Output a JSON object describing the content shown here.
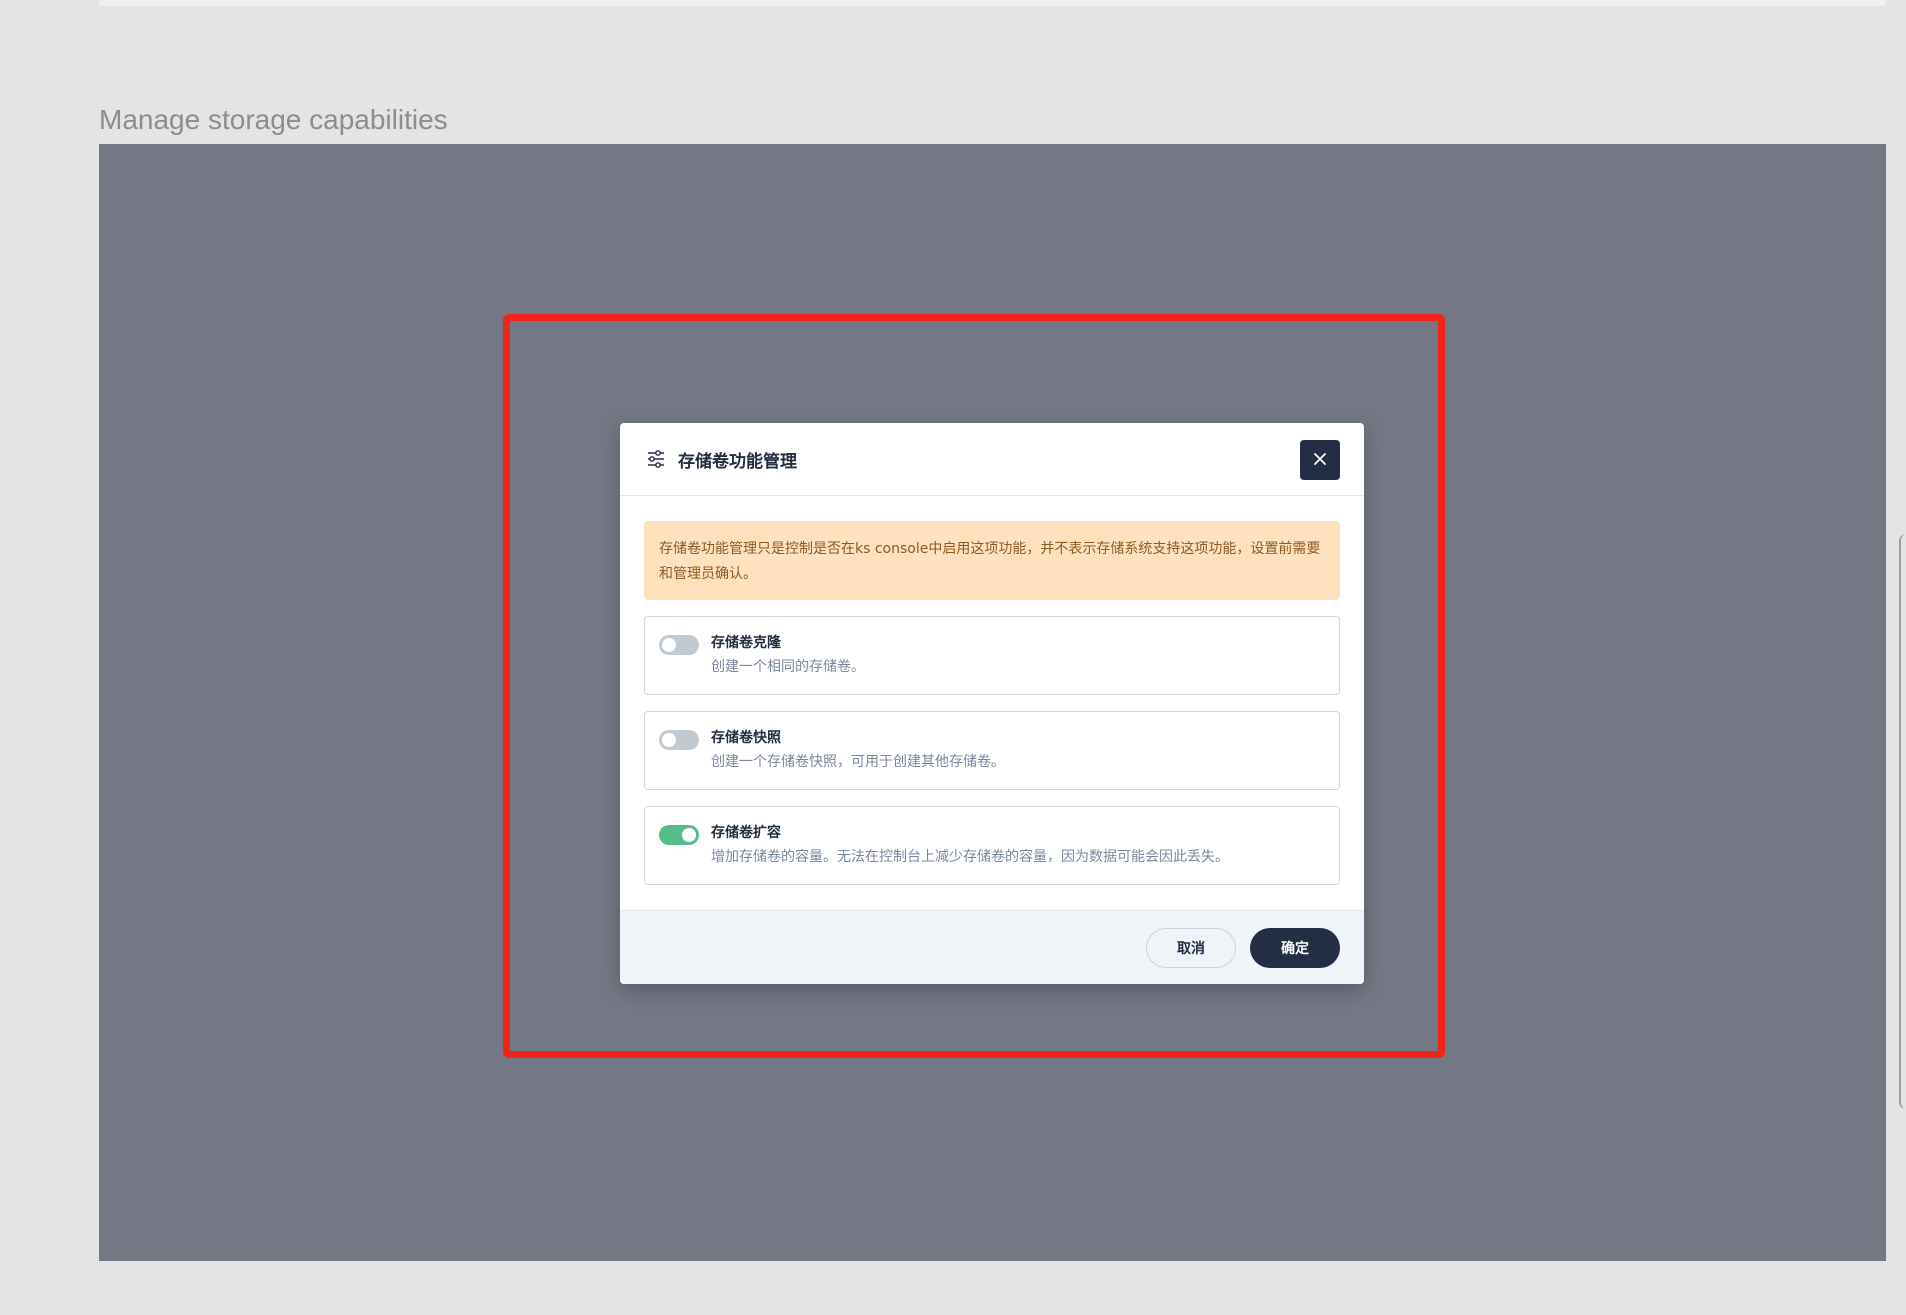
{
  "page": {
    "section_title": "Manage storage capabilities"
  },
  "modal": {
    "title": "存储卷功能管理",
    "header_icon": "sliders-icon",
    "close_icon": "close-icon",
    "warning": "存储卷功能管理只是控制是否在ks console中启用这项功能，并不表示存储系统支持这项功能，设置前需要和管理员确认。",
    "features": [
      {
        "name": "存储卷克隆",
        "description": "创建一个相同的存储卷。",
        "enabled": false
      },
      {
        "name": "存储卷快照",
        "description": "创建一个存储卷快照，可用于创建其他存储卷。",
        "enabled": false
      },
      {
        "name": "存储卷扩容",
        "description": "增加存储卷的容量。无法在控制台上减少存储卷的容量，因为数据可能会因此丢失。",
        "enabled": true
      }
    ],
    "cancel_label": "取消",
    "ok_label": "确定"
  },
  "colors": {
    "overlay": "#737884",
    "highlight": "#f0241b",
    "primary": "#242e42",
    "toggle_on": "#55bc8a",
    "toggle_off": "#c1c9d1",
    "warning_bg": "#ffe1be",
    "warning_text": "#8e5b22"
  }
}
